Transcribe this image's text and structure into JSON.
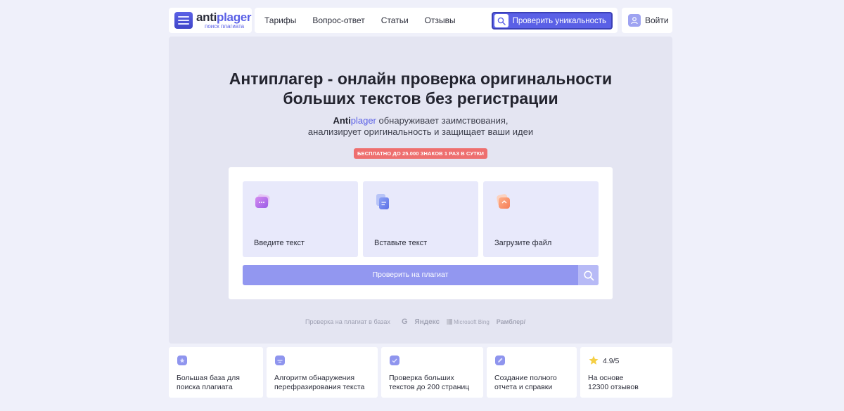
{
  "header": {
    "logo": {
      "main_a": "anti",
      "main_p": "plager",
      "sub": "поиск плагиата"
    },
    "nav": [
      "Тарифы",
      "Вопрос-ответ",
      "Статьи",
      "Отзывы"
    ],
    "check_button": "Проверить уникальность",
    "login": "Войти"
  },
  "hero": {
    "title_line1": "Антиплагер - онлайн проверка оригинальности",
    "title_line2": "больших текстов без регистрации",
    "sub_brand_a": "Anti",
    "sub_brand_p": "plager",
    "sub_line1_rest": " обнаруживает заимствования,",
    "sub_line2": "анализирует оригинальность и защищает ваши идеи",
    "promo": "БЕСПЛАТНО ДО 25.000 ЗНАКОВ 1 РАЗ В СУТКИ",
    "options": [
      {
        "label": "Введите текст",
        "icon": "chat-icon"
      },
      {
        "label": "Вставьте текст",
        "icon": "paste-document-icon"
      },
      {
        "label": "Загрузите файл",
        "icon": "upload-file-icon"
      }
    ],
    "submit": "Проверить на плагиат",
    "engines_label": "Проверка на плагиат в базах",
    "engines": {
      "google": "G",
      "yandex": "Яндекс",
      "bing": "Microsoft Bing",
      "rambler": "Рамблер/"
    }
  },
  "features": [
    {
      "line1": "Большая база для",
      "line2": "поиска плагиата",
      "icon": "database-icon"
    },
    {
      "line1": "Алгоритм обнаружения",
      "line2": "перефразирования текста",
      "icon": "algorithm-icon"
    },
    {
      "line1": "Проверка больших",
      "line2": "текстов до 200 страниц",
      "icon": "pages-icon"
    },
    {
      "line1": "Создание полного",
      "line2": "отчета и справки",
      "icon": "report-icon"
    },
    {
      "line1": "На основе",
      "line2": "12300 отзывов",
      "icon": "star-icon",
      "rating": "4.9/5"
    }
  ],
  "colors": {
    "accent": "#5a60e6",
    "promo": "#ee6f6f",
    "submit": "#9297f0"
  }
}
